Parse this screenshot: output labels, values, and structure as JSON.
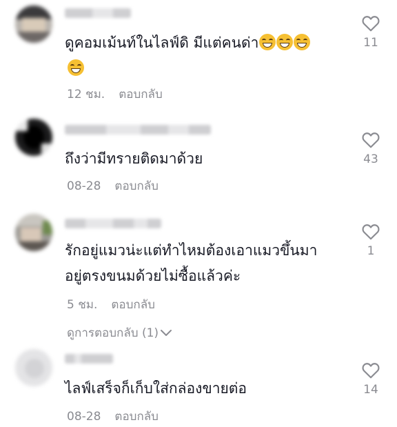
{
  "comments": [
    {
      "text": "ดูคอมเม้นท์ในไลฟ์ดิ มีแต่คนด่า",
      "emoji": [
        "grinning-squinting-emoji",
        "grinning-squinting-emoji",
        "grinning-squinting-emoji",
        "grinning-squinting-emoji"
      ],
      "time": "12 ชม.",
      "reply": "ตอบกลับ",
      "likes": "11"
    },
    {
      "text": "ถึงว่ามีทรายติดมาด้วย",
      "time": "08-28",
      "reply": "ตอบกลับ",
      "likes": "43"
    },
    {
      "text": "รักอยู่แมวน่ะแต่ทำไหมต้องเอาแมวขึ้นมา\nอยู่ตรงขนมด้วยไม่ซื้อแล้วค่ะ",
      "time": "5 ชม.",
      "reply": "ตอบกลับ",
      "likes": "1",
      "view_replies": "ดูการตอบกลับ (1)"
    },
    {
      "text": "ไลฟ์เสร็จก็เก็บใส่กล่องขายต่อ",
      "time": "08-28",
      "reply": "ตอบกลับ",
      "likes": "14"
    }
  ],
  "colors": {
    "text": "#161823",
    "muted": "#8a8b91",
    "emoji": "#f6c033"
  }
}
